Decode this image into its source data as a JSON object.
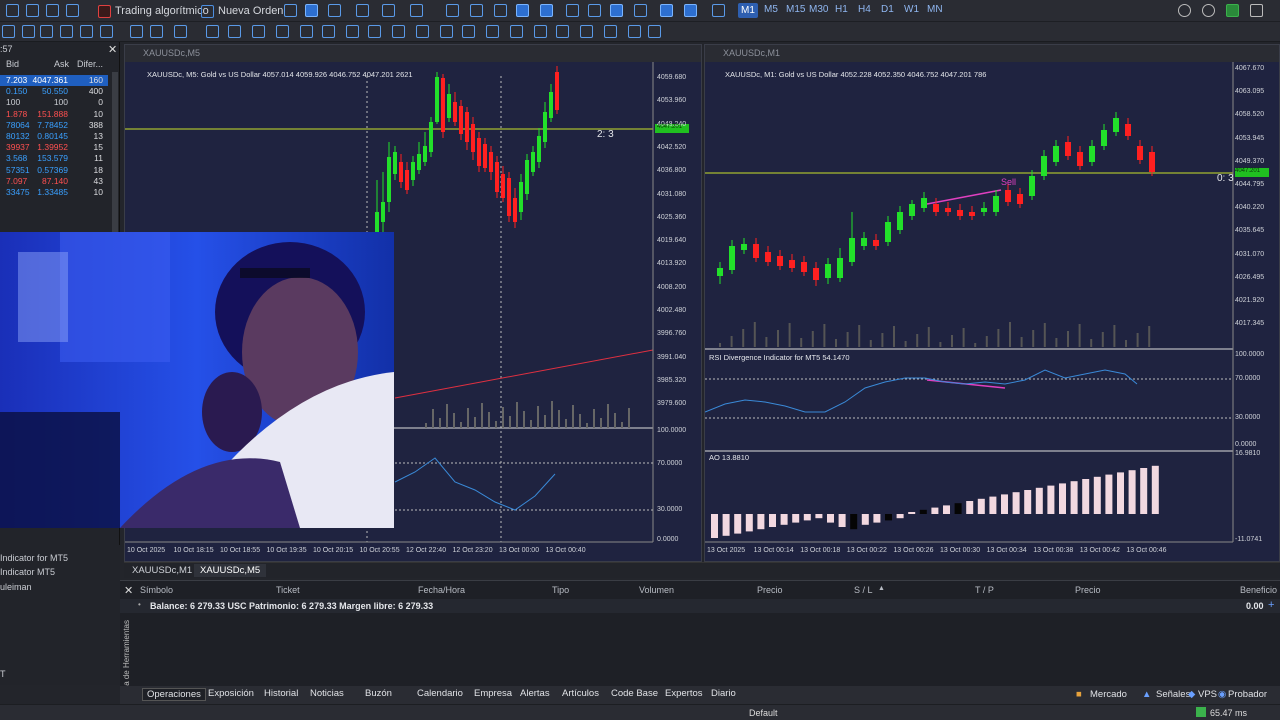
{
  "toolbar": {
    "algo_trading": "Trading algorítmico",
    "new_order": "Nueva Orden",
    "timeframes": [
      "M1",
      "M5",
      "M15",
      "M30",
      "H1",
      "H4",
      "D1",
      "W1",
      "MN"
    ],
    "selected_tf": "M1"
  },
  "market_watch": {
    "time": ":57",
    "headers": [
      "Bid",
      "Ask",
      "Difer..."
    ],
    "rows": [
      {
        "bid": "7.203",
        "ask": "4047.361",
        "spread": "160"
      },
      {
        "bid": "0.150",
        "ask": "50.550",
        "spread": "400"
      },
      {
        "bid": "100",
        "ask": "100",
        "spread": "0"
      },
      {
        "bid": "1.878",
        "ask": "151.888",
        "spread": "10"
      },
      {
        "bid": "78064",
        "ask": "7.78452",
        "spread": "388"
      },
      {
        "bid": "80132",
        "ask": "0.80145",
        "spread": "13"
      },
      {
        "bid": "39937",
        "ask": "1.39952",
        "spread": "15"
      },
      {
        "bid": "3.568",
        "ask": "153.579",
        "spread": "11"
      },
      {
        "bid": "57351",
        "ask": "0.57369",
        "spread": "18"
      },
      {
        "bid": "7.097",
        "ask": "87.140",
        "spread": "43"
      },
      {
        "bid": "33475",
        "ask": "1.33485",
        "spread": "10"
      }
    ]
  },
  "navigator": {
    "items": [
      "Indicator for MT5",
      "Indicator MT5",
      "uleiman",
      "T"
    ]
  },
  "chart1": {
    "window_title": "XAUUSDc,M5",
    "info": "XAUUSDc, M5:  Gold vs US Dollar  4057.014 4059.926 4046.752 4047.201  2621",
    "ratio_label": "2: 3",
    "current_price": "4047.201",
    "price_scale": [
      "4059.680",
      "4053.960",
      "4048.240",
      "4042.520",
      "4036.800",
      "4031.080",
      "4025.360",
      "4019.640",
      "4013.920",
      "4008.200",
      "4002.480",
      "3996.760",
      "3991.040",
      "3985.320",
      "3979.600"
    ],
    "rsi_scale": [
      "100.0000",
      "70.0000",
      "30.0000",
      "0.0000"
    ],
    "time_axis": [
      "10 Oct 2025",
      "10 Oct 18:15",
      "10 Oct 18:55",
      "10 Oct 19:35",
      "10 Oct 20:15",
      "10 Oct 20:55",
      "12 Oct 22:40",
      "12 Oct 23:20",
      "13 Oct 00:00",
      "13 Oct 00:40"
    ]
  },
  "chart2": {
    "window_title": "XAUUSDc,M1",
    "info": "XAUUSDc, M1:  Gold vs US Dollar  4052.228 4052.350 4046.752 4047.201  786",
    "ratio_label": "0: 3",
    "sell_label": "Sell",
    "current_price": "4047.201",
    "price_scale": [
      "4067.670",
      "4063.095",
      "4058.520",
      "4053.945",
      "4049.370",
      "4044.795",
      "4040.220",
      "4035.645",
      "4031.070",
      "4026.495",
      "4021.920",
      "4017.345"
    ],
    "rsi_label": "RSI Divergence Indicator for MT5 54.1470",
    "rsi_scale": [
      "100.0000",
      "70.0000",
      "30.0000",
      "0.0000"
    ],
    "ao_label": "AO 13.8810",
    "ao_scale": [
      "16.9810",
      "-11.0741"
    ],
    "time_axis": [
      "13 Oct 2025",
      "13 Oct 00:14",
      "13 Oct 00:18",
      "13 Oct 00:22",
      "13 Oct 00:26",
      "13 Oct 00:30",
      "13 Oct 00:34",
      "13 Oct 00:38",
      "13 Oct 00:42",
      "13 Oct 00:46"
    ]
  },
  "chart_tabs": [
    "XAUUSDc,M1",
    "XAUUSDc,M5"
  ],
  "toolbox": {
    "headers": [
      "Símbolo",
      "Ticket",
      "Fecha/Hora",
      "Tipo",
      "Volumen",
      "Precio",
      "S / L",
      "T / P",
      "Precio",
      "Beneficio"
    ],
    "balance_line": "Balance: 6 279.33 USC  Patrimonio: 6 279.33  Margen libre: 6 279.33",
    "profit": "0.00",
    "side_label": "Caja de Herramientas"
  },
  "bottom_tabs": [
    "Operaciones",
    "Exposición",
    "Historial",
    "Noticias",
    "Buzón",
    "Calendario",
    "Empresa",
    "Alertas",
    "Artículos",
    "Code Base",
    "Expertos",
    "Diario"
  ],
  "status": {
    "profile": "Default",
    "right_items": [
      "Mercado",
      "Señales",
      "VPS",
      "Probador"
    ],
    "ping": "65.47 ms"
  },
  "colors": {
    "bull": "#22e02a",
    "bear": "#ff2020",
    "chart_bg": "#1f2340",
    "price_line": "#c8e02a",
    "rsi": "#3a8ad8",
    "divergence": "#e040c0"
  }
}
